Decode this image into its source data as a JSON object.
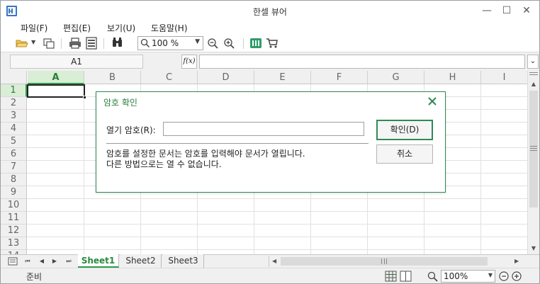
{
  "window": {
    "title": "한셀 뷰어",
    "controls": {
      "minimize": "—",
      "maximize": "☐",
      "close": "✕"
    }
  },
  "menu": {
    "items": [
      {
        "label": "파일(F)"
      },
      {
        "label": "편집(E)"
      },
      {
        "label": "보기(U)"
      },
      {
        "label": "도움말(H)"
      }
    ]
  },
  "toolbar": {
    "icons": [
      "open-folder-icon",
      "new-window-icon",
      "print-icon",
      "print-preview-icon",
      "find-icon",
      "zoom-out-icon",
      "zoom-in-icon",
      "hancom-icon",
      "cart-icon"
    ],
    "zoom_value": "100 %"
  },
  "formula_bar": {
    "cell_name": "A1",
    "fx_label": "f(x)",
    "formula_value": ""
  },
  "grid": {
    "columns": [
      "A",
      "B",
      "C",
      "D",
      "E",
      "F",
      "G",
      "H",
      "I"
    ],
    "rows": [
      "1",
      "2",
      "3",
      "4",
      "5",
      "6",
      "7",
      "8",
      "9",
      "10",
      "11",
      "12",
      "13",
      "14"
    ],
    "active_cell": "A1"
  },
  "sheets": {
    "tabs": [
      "Sheet1",
      "Sheet2",
      "Sheet3"
    ],
    "active": "Sheet1"
  },
  "status": {
    "text": "준비",
    "zoom": "100%"
  },
  "dialog": {
    "title": "암호 확인",
    "field_label": "열기 암호(R):",
    "password_value": "",
    "message_line1": "암호를 설정한 문서는 암호를 입력해야 문서가 열립니다.",
    "message_line2": "다른 방법으로는 열 수 없습니다.",
    "ok_label": "확인(D)",
    "cancel_label": "취소"
  },
  "colors": {
    "accent": "#2f8a55",
    "active_header": "#d9eed5"
  }
}
